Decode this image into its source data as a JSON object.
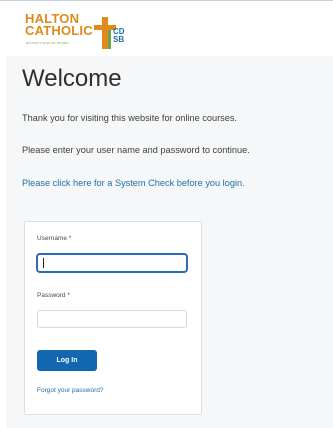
{
  "brand": {
    "line1": "HALTON",
    "line2": "CATHOLIC",
    "subtitle": "DISTRICT SCHOOL BOARD",
    "cds_top": "CD",
    "cds_bottom": "SB",
    "colors": {
      "orange": "#e08a1e",
      "green": "#6aa54a",
      "blue": "#1f6fa8"
    }
  },
  "page": {
    "title": "Welcome",
    "intro": "Thank you for visiting this website for online courses.",
    "instruction": "Please enter your user name and password to continue.",
    "system_check_link": "Please click here for a System Check before you login."
  },
  "login": {
    "username_label": "Username *",
    "username_value": "",
    "password_label": "Password *",
    "password_value": "",
    "submit_label": "Log In",
    "forgot_link": "Forgot your password?",
    "button_color": "#1267b0"
  }
}
